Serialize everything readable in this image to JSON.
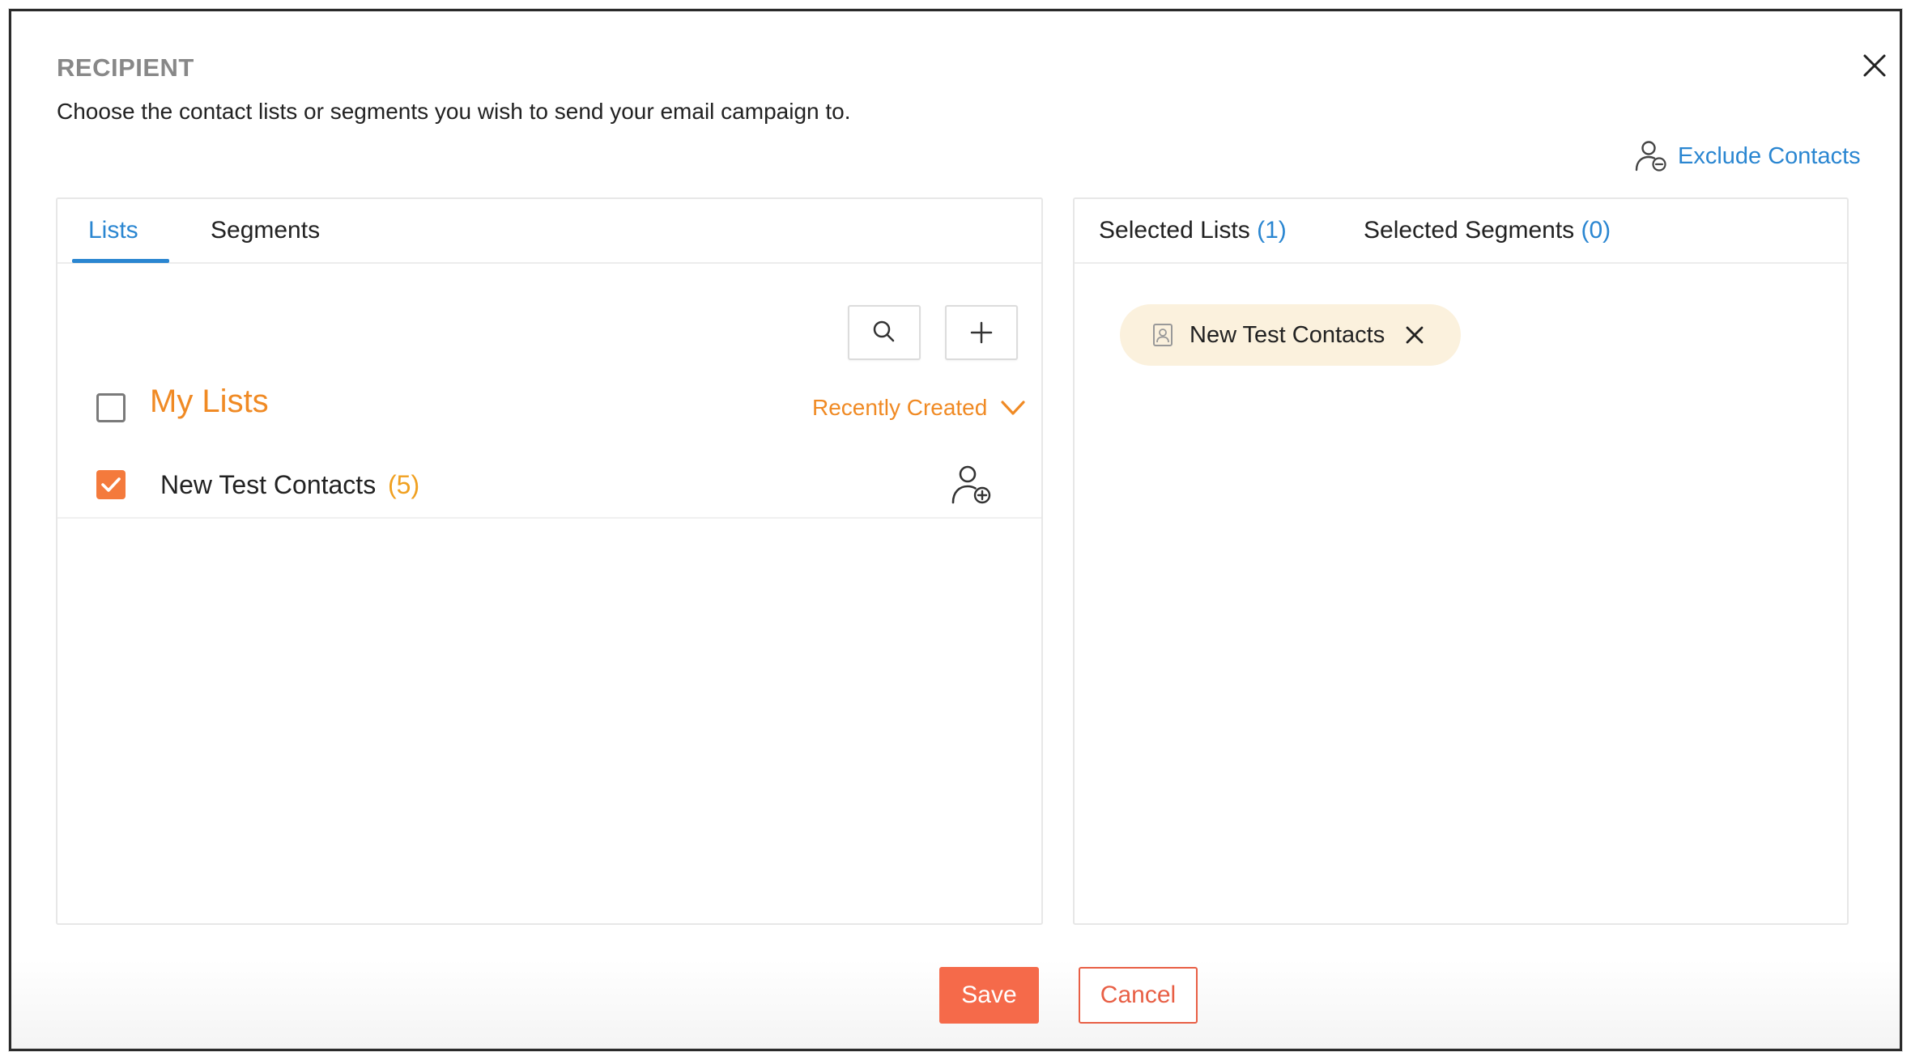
{
  "dialog": {
    "title": "RECIPIENT",
    "subtitle": "Choose the contact lists or segments you wish to send your email campaign to.",
    "close_icon": "close-icon"
  },
  "exclude": {
    "label": "Exclude Contacts",
    "icon": "user-minus-icon"
  },
  "left_panel": {
    "tabs": [
      {
        "label": "Lists",
        "active": true
      },
      {
        "label": "Segments",
        "active": false
      }
    ],
    "tools": {
      "search_icon": "search-icon",
      "add_icon": "plus-icon"
    },
    "group": {
      "label": "My Lists",
      "checked": false,
      "sort_label": "Recently Created"
    },
    "items": [
      {
        "name": "New Test Contacts",
        "count": "(5)",
        "checked": true
      }
    ]
  },
  "right_panel": {
    "tabs": [
      {
        "label": "Selected Lists",
        "count": "(1)"
      },
      {
        "label": "Selected Segments",
        "count": "(0)"
      }
    ],
    "chips": [
      {
        "label": "New Test Contacts"
      }
    ]
  },
  "footer": {
    "save_label": "Save",
    "cancel_label": "Cancel"
  },
  "colors": {
    "accent_blue": "#2a86d1",
    "accent_orange": "#f08a24",
    "checkbox_orange": "#f47a3c",
    "save_button": "#f56a4a",
    "chip_bg": "#fbf1dd"
  }
}
